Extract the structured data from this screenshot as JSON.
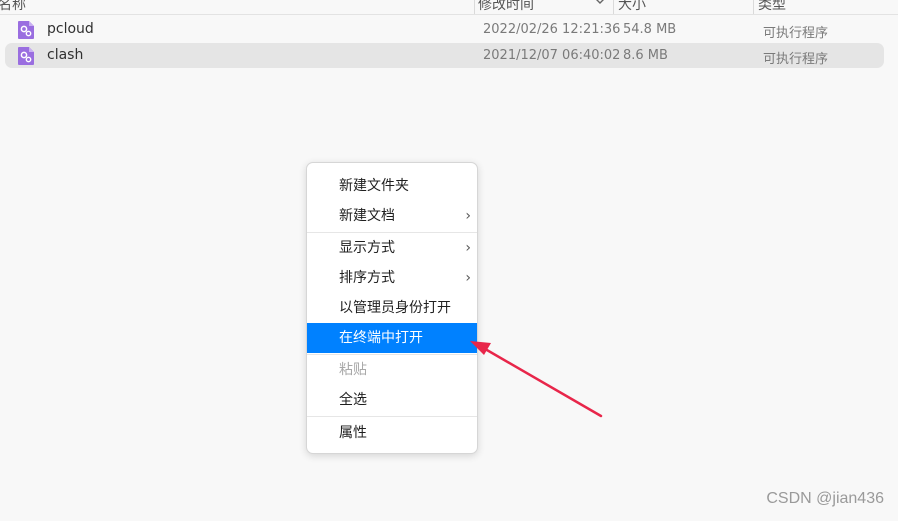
{
  "header": {
    "name": "名称",
    "modified": "修改时间",
    "size": "大小",
    "type": "类型"
  },
  "files": [
    {
      "name": "pcloud",
      "modified": "2022/02/26 12:21:36",
      "size": "54.8 MB",
      "type": "可执行程序",
      "selected": false
    },
    {
      "name": "clash",
      "modified": "2021/12/07 06:40:02",
      "size": "8.6 MB",
      "type": "可执行程序",
      "selected": true
    }
  ],
  "context_menu": {
    "items": [
      {
        "label": "新建文件夹",
        "submenu": false
      },
      {
        "label": "新建文档",
        "submenu": true
      },
      {
        "label": "显示方式",
        "submenu": true
      },
      {
        "label": "排序方式",
        "submenu": true
      },
      {
        "label": "以管理员身份打开",
        "submenu": false
      },
      {
        "label": "在终端中打开",
        "submenu": false,
        "highlighted": true
      },
      {
        "label": "粘贴",
        "submenu": false,
        "disabled": true
      },
      {
        "label": "全选",
        "submenu": false
      },
      {
        "label": "属性",
        "submenu": false
      }
    ],
    "highlight_color": "#0081ff"
  },
  "icons": {
    "file": "executable-gear-icon",
    "submenu": "chevron-right-icon",
    "sort": "chevron-down-icon"
  },
  "annotation_color": "#e8264a",
  "watermark": "CSDN @jian436"
}
